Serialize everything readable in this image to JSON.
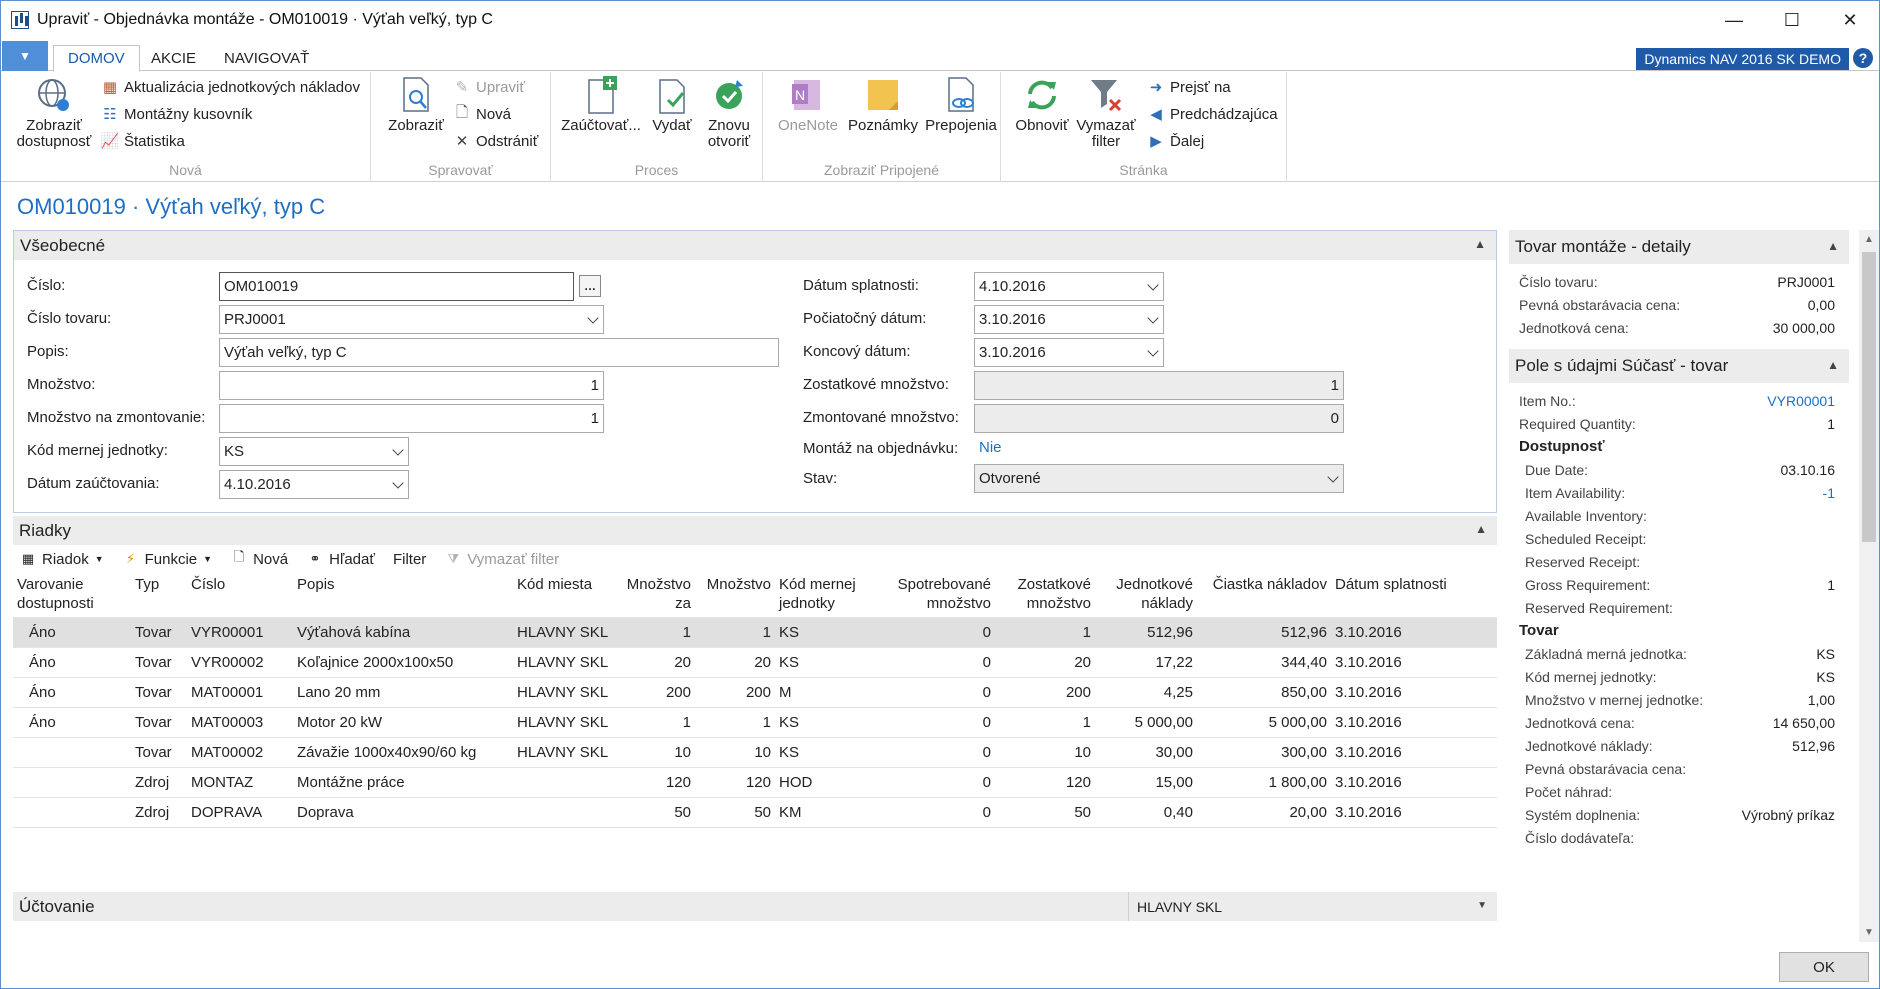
{
  "window": {
    "title": "Upraviť - Objednávka montáže - OM010019 · Výťah veľký, typ C",
    "minimize": "—",
    "maximize": "☐",
    "close": "✕"
  },
  "ribbon": {
    "file_arrow": "▼",
    "tabs": [
      "DOMOV",
      "AKCIE",
      "NAVIGOVAŤ"
    ],
    "brand": "Dynamics NAV 2016 SK DEMO",
    "help": "?",
    "groups": {
      "nova": {
        "label": "Nová",
        "big": "Zobraziť dostupnosť",
        "small": [
          "Aktualizácia jednotkových nákladov",
          "Montážny kusovník",
          "Štatistika"
        ]
      },
      "spravovat": {
        "label": "Spravovať",
        "big": "Zobraziť",
        "small": [
          "Upraviť",
          "Nová",
          "Odstrániť"
        ]
      },
      "proces": {
        "label": "Proces",
        "buttons": [
          "Zaúčtovať...",
          "Vydať",
          "Znovu otvoriť"
        ]
      },
      "pripojene": {
        "label": "Zobraziť Pripojené",
        "buttons": [
          "OneNote",
          "Poznámky",
          "Prepojenia"
        ]
      },
      "stranka": {
        "label": "Stránka",
        "buttons": [
          "Obnoviť",
          "Vymazať filter"
        ],
        "small": [
          "Prejsť na",
          "Predchádzajúca",
          "Ďalej"
        ]
      }
    }
  },
  "page_title": "OM010019 · Výťah veľký, typ C",
  "general": {
    "header": "Všeobecné",
    "fields": {
      "cislo": {
        "label": "Číslo:",
        "value": "OM010019"
      },
      "cislo_tovaru": {
        "label": "Číslo tovaru:",
        "value": "PRJ0001"
      },
      "popis": {
        "label": "Popis:",
        "value": "Výťah veľký, typ C"
      },
      "mnozstvo": {
        "label": "Množstvo:",
        "value": "1"
      },
      "mnozstvo_zmont": {
        "label": "Množstvo na zmontovanie:",
        "value": "1"
      },
      "kod_mj": {
        "label": "Kód mernej jednotky:",
        "value": "KS"
      },
      "datum_zauct": {
        "label": "Dátum zaúčtovania:",
        "value": "4.10.2016"
      },
      "datum_splat": {
        "label": "Dátum splatnosti:",
        "value": "4.10.2016"
      },
      "poc_datum": {
        "label": "Počiatočný dátum:",
        "value": "3.10.2016"
      },
      "kon_datum": {
        "label": "Koncový dátum:",
        "value": "3.10.2016"
      },
      "zost_mnoz": {
        "label": "Zostatkové množstvo:",
        "value": "1"
      },
      "zmont_mnoz": {
        "label": "Zmontované množstvo:",
        "value": "0"
      },
      "montaz_obj": {
        "label": "Montáž na objednávku:",
        "value": "Nie"
      },
      "stav": {
        "label": "Stav:",
        "value": "Otvorené"
      }
    }
  },
  "lines": {
    "header": "Riadky",
    "toolbar": [
      "Riadok",
      "Funkcie",
      "Nová",
      "Hľadať",
      "Filter",
      "Vymazať filter"
    ],
    "columns": [
      "Varovanie dostupnosti",
      "Typ",
      "Číslo",
      "Popis",
      "Kód miesta",
      "Množstvo za",
      "Množstvo",
      "Kód mernej jednotky",
      "Spotrebované množstvo",
      "Zostatkové množstvo",
      "Jednotkové náklady",
      "Čiastka nákladov",
      "Dátum splatnosti"
    ],
    "rows": [
      [
        "Áno",
        "Tovar",
        "VYR00001",
        "Výťahová kabína",
        "HLAVNY SKL",
        "1",
        "1",
        "KS",
        "0",
        "1",
        "512,96",
        "512,96",
        "3.10.2016"
      ],
      [
        "Áno",
        "Tovar",
        "VYR00002",
        "Koľajnice 2000x100x50",
        "HLAVNY SKL",
        "20",
        "20",
        "KS",
        "0",
        "20",
        "17,22",
        "344,40",
        "3.10.2016"
      ],
      [
        "Áno",
        "Tovar",
        "MAT00001",
        "Lano 20 mm",
        "HLAVNY SKL",
        "200",
        "200",
        "M",
        "0",
        "200",
        "4,25",
        "850,00",
        "3.10.2016"
      ],
      [
        "Áno",
        "Tovar",
        "MAT00003",
        "Motor 20 kW",
        "HLAVNY SKL",
        "1",
        "1",
        "KS",
        "0",
        "1",
        "5 000,00",
        "5 000,00",
        "3.10.2016"
      ],
      [
        "",
        "Tovar",
        "MAT00002",
        "Závažie 1000x40x90/60 kg",
        "HLAVNY SKL",
        "10",
        "10",
        "KS",
        "0",
        "10",
        "30,00",
        "300,00",
        "3.10.2016"
      ],
      [
        "",
        "Zdroj",
        "MONTAZ",
        "Montážne práce",
        "",
        "120",
        "120",
        "HOD",
        "0",
        "120",
        "15,00",
        "1 800,00",
        "3.10.2016"
      ],
      [
        "",
        "Zdroj",
        "DOPRAVA",
        "Doprava",
        "",
        "50",
        "50",
        "KM",
        "0",
        "50",
        "0,40",
        "20,00",
        "3.10.2016"
      ]
    ]
  },
  "posting": {
    "header": "Účtovanie",
    "summary": "HLAVNY SKL"
  },
  "factbox1": {
    "header": "Tovar montáže - detaily",
    "rows": [
      {
        "label": "Číslo tovaru:",
        "value": "PRJ0001"
      },
      {
        "label": "Pevná obstarávacia cena:",
        "value": "0,00"
      },
      {
        "label": "Jednotková cena:",
        "value": "30 000,00"
      }
    ]
  },
  "factbox2": {
    "header": "Pole s údajmi Súčasť - tovar",
    "item_no": {
      "label": "Item No.:",
      "value": "VYR00001"
    },
    "req_qty": {
      "label": "Required Quantity:",
      "value": "1"
    },
    "sec_dost": "Dostupnosť",
    "dost_rows": [
      {
        "label": "Due Date:",
        "value": "03.10.16"
      },
      {
        "label": "Item Availability:",
        "value": "-1"
      },
      {
        "label": "Available Inventory:",
        "value": ""
      },
      {
        "label": "Scheduled Receipt:",
        "value": ""
      },
      {
        "label": "Reserved Receipt:",
        "value": ""
      },
      {
        "label": "Gross Requirement:",
        "value": "1"
      },
      {
        "label": "Reserved Requirement:",
        "value": ""
      }
    ],
    "sec_tovar": "Tovar",
    "tovar_rows": [
      {
        "label": "Základná merná jednotka:",
        "value": "KS"
      },
      {
        "label": "Kód mernej jednotky:",
        "value": "KS"
      },
      {
        "label": "Množstvo v mernej jednotke:",
        "value": "1,00"
      },
      {
        "label": "Jednotková cena:",
        "value": "14 650,00"
      },
      {
        "label": "Jednotkové náklady:",
        "value": "512,96"
      },
      {
        "label": "Pevná obstarávacia cena:",
        "value": ""
      },
      {
        "label": "Počet náhrad:",
        "value": ""
      },
      {
        "label": "Systém doplnenia:",
        "value": "Výrobný príkaz"
      },
      {
        "label": "Číslo dodávateľa:",
        "value": ""
      }
    ]
  },
  "ok_button": "OK",
  "colors": {
    "accent": "#1e6fc4",
    "brand": "#1e5aa8",
    "header_bg": "#ececec"
  }
}
